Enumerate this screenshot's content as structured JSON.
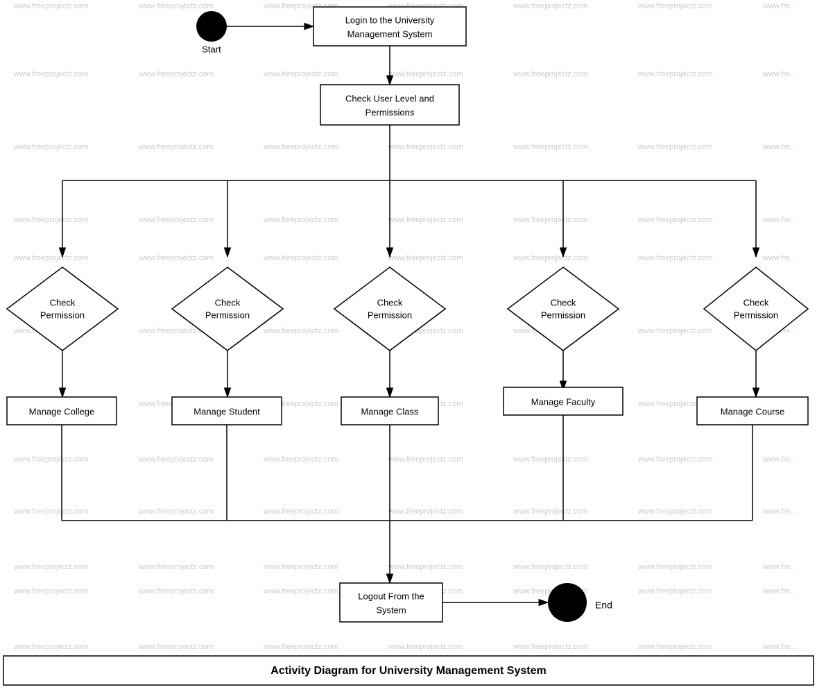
{
  "diagram": {
    "title": "Activity Diagram for University Management System",
    "watermark": "www.freeprojectz.com",
    "nodes": {
      "start": {
        "label": "Start",
        "type": "circle"
      },
      "login": {
        "label": "Login to the University\nManagement System",
        "type": "rect"
      },
      "checkPermissions": {
        "label": "Check User Level and\nPermissions",
        "type": "rect"
      },
      "checkPerm1": {
        "label": "Check\nPermission",
        "type": "diamond"
      },
      "checkPerm2": {
        "label": "Check\nPermission",
        "type": "diamond"
      },
      "checkPerm3": {
        "label": "Check\nPermission",
        "type": "diamond"
      },
      "checkPerm4": {
        "label": "Check\nPermission",
        "type": "diamond"
      },
      "checkPerm5": {
        "label": "Check\nPermission",
        "type": "diamond"
      },
      "manageCollege": {
        "label": "Manage College",
        "type": "rect"
      },
      "manageStudent": {
        "label": "Manage Student",
        "type": "rect"
      },
      "manageClass": {
        "label": "Manage Class",
        "type": "rect"
      },
      "manageFaculty": {
        "label": "Manage Faculty",
        "type": "rect"
      },
      "manageCourse": {
        "label": "Manage Course",
        "type": "rect"
      },
      "logout": {
        "label": "Logout From the\nSystem",
        "type": "rect"
      },
      "end": {
        "label": "End",
        "type": "circle"
      }
    }
  }
}
